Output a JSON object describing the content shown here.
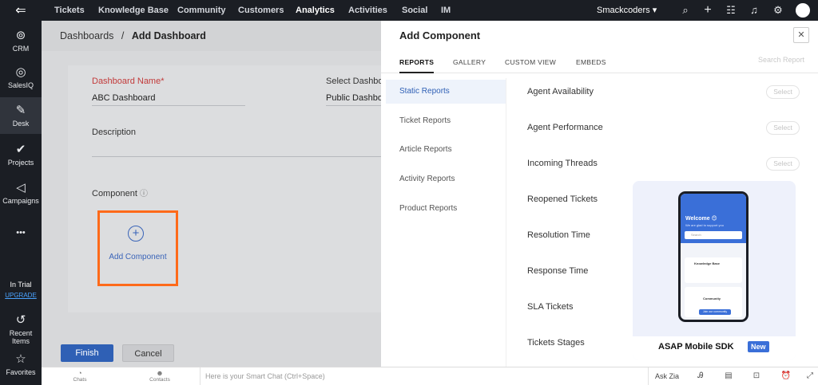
{
  "leftbar": {
    "items": [
      {
        "label": "CRM",
        "icon": "crm-icon",
        "glyph": "⊚"
      },
      {
        "label": "SalesIQ",
        "icon": "salesiq-icon",
        "glyph": "◎"
      },
      {
        "label": "Desk",
        "icon": "desk-icon",
        "glyph": "✎"
      },
      {
        "label": "Projects",
        "icon": "projects-icon",
        "glyph": "✔"
      },
      {
        "label": "Campaigns",
        "icon": "campaigns-icon",
        "glyph": "◁"
      }
    ],
    "more": "•••",
    "trial_label": "In Trial",
    "upgrade_label": "UPGRADE",
    "recent": "Recent Items",
    "favorites": "Favorites"
  },
  "topnav": {
    "tabs": [
      "Tickets",
      "Knowledge Base",
      "Community",
      "Customers",
      "Analytics",
      "Activities",
      "Social",
      "IM"
    ],
    "active": "Analytics",
    "org": "Smackcoders ▾"
  },
  "breadcrumb": {
    "parent": "Dashboards",
    "sep": "/",
    "current": "Add Dashboard"
  },
  "form": {
    "name_label": "Dashboard Name",
    "name_value": "ABC Dashboard",
    "select_label": "Select Dashbo",
    "select_value": "Public Dashbo",
    "desc_label": "Description",
    "component_label": "Component",
    "add_component": "Add Component",
    "finish": "Finish",
    "cancel": "Cancel"
  },
  "panel": {
    "title": "Add Component",
    "close": "✕",
    "tabs": [
      "REPORTS",
      "GALLERY",
      "CUSTOM VIEW",
      "EMBEDS"
    ],
    "active_tab": "REPORTS",
    "search_placeholder": "Search Report",
    "categories": [
      "Static Reports",
      "Ticket Reports",
      "Article Reports",
      "Activity Reports",
      "Product Reports"
    ],
    "active_category": "Static Reports",
    "reports": [
      "Agent Availability",
      "Agent Performance",
      "Incoming Threads",
      "Reopened Tickets",
      "Resolution Time",
      "Response Time",
      "SLA Tickets",
      "Tickets Stages"
    ],
    "select_label": "Select"
  },
  "promo": {
    "title": "ASAP Mobile SDK",
    "badge": "New",
    "welcome": "Welcome 😊",
    "welcome_sub": "We are glad to support you",
    "search": "Search",
    "kb_title": "Knowledge Base",
    "community_title": "Community",
    "community_btn": "Join our community"
  },
  "bottombar": {
    "chats": "Chats",
    "contacts": "Contacts",
    "smart_chat_placeholder": "Here is your Smart Chat (Ctrl+Space)",
    "ask_zia": "Ask Zia"
  }
}
